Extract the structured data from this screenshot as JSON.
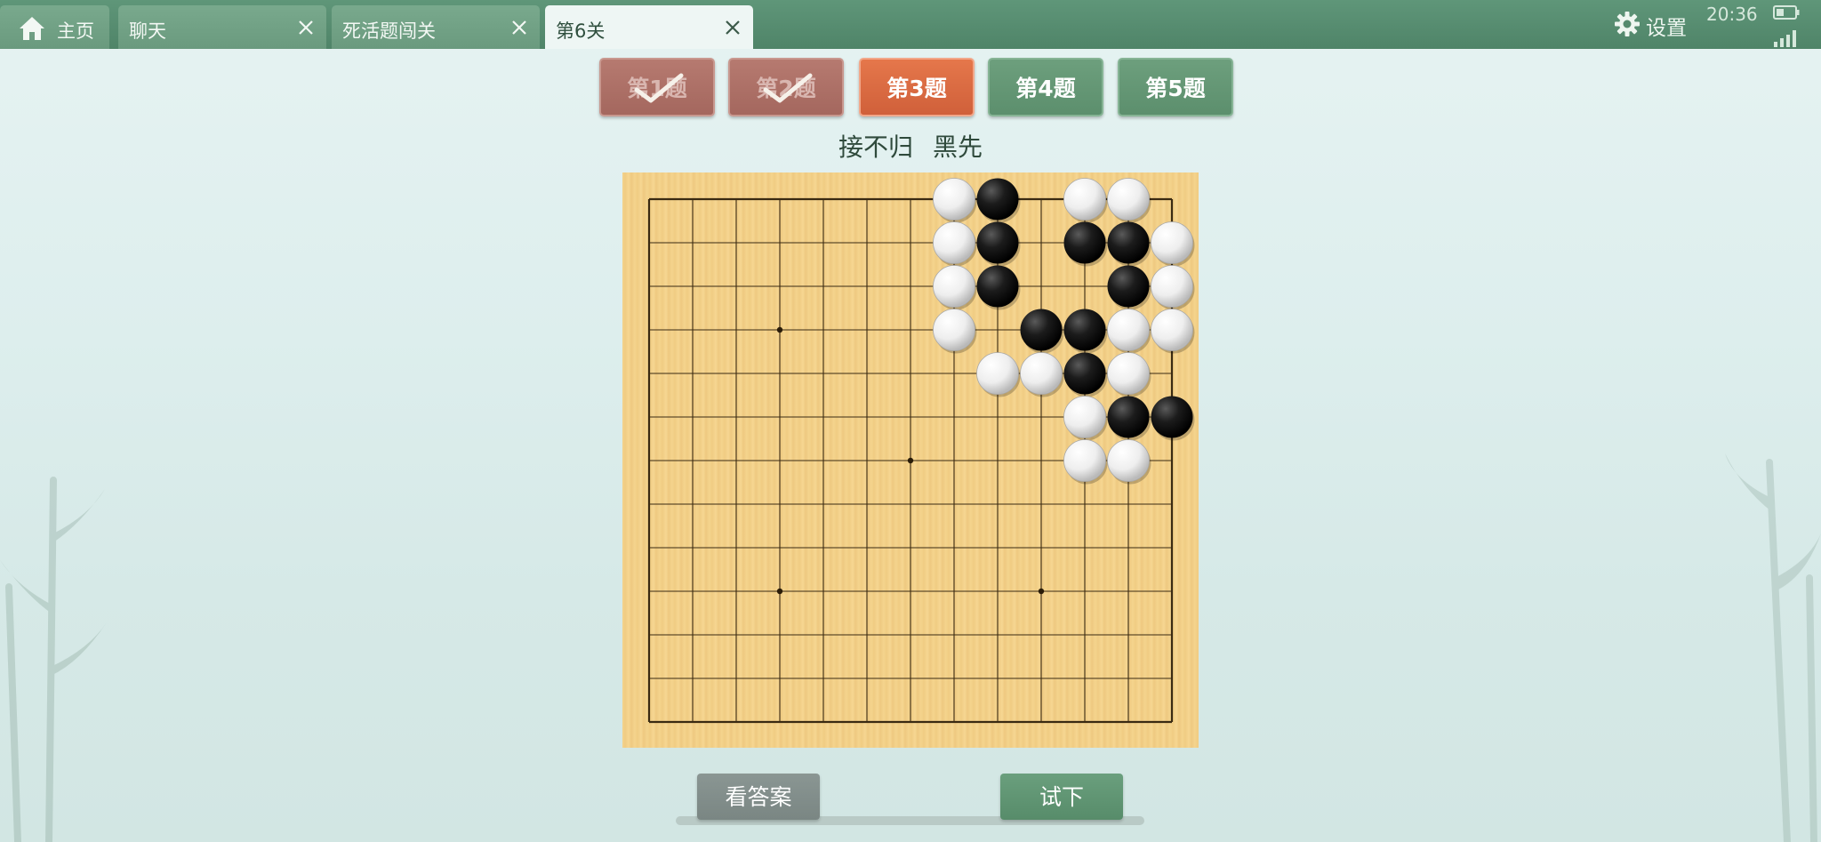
{
  "tabs": [
    {
      "label": "主页",
      "icon": "home-icon",
      "closable": false,
      "active": false
    },
    {
      "label": "聊天",
      "closable": true,
      "active": false
    },
    {
      "label": "死活题闯关",
      "closable": true,
      "active": false
    },
    {
      "label": "第6关",
      "closable": true,
      "active": true
    }
  ],
  "status": {
    "settings_label": "设置",
    "settings_icon": "gear-icon",
    "time": "20:36",
    "battery_icon": "battery-icon",
    "signal_icon": "signal-icon"
  },
  "problems": [
    {
      "label": "第1题",
      "state": "done"
    },
    {
      "label": "第2题",
      "state": "done"
    },
    {
      "label": "第3题",
      "state": "current"
    },
    {
      "label": "第4题",
      "state": "todo"
    },
    {
      "label": "第5题",
      "state": "todo"
    }
  ],
  "problem": {
    "theme": "接不归",
    "to_play": "黑先"
  },
  "board": {
    "size": 13,
    "star_points": [
      [
        3,
        3
      ],
      [
        6,
        6
      ],
      [
        3,
        9
      ],
      [
        9,
        9
      ]
    ],
    "stones": [
      {
        "color": "white",
        "col": 7,
        "row": 0
      },
      {
        "color": "black",
        "col": 8,
        "row": 0
      },
      {
        "color": "white",
        "col": 10,
        "row": 0
      },
      {
        "color": "white",
        "col": 11,
        "row": 0
      },
      {
        "color": "white",
        "col": 7,
        "row": 1
      },
      {
        "color": "black",
        "col": 8,
        "row": 1
      },
      {
        "color": "black",
        "col": 10,
        "row": 1
      },
      {
        "color": "black",
        "col": 11,
        "row": 1
      },
      {
        "color": "white",
        "col": 12,
        "row": 1
      },
      {
        "color": "white",
        "col": 7,
        "row": 2
      },
      {
        "color": "black",
        "col": 8,
        "row": 2
      },
      {
        "color": "black",
        "col": 11,
        "row": 2
      },
      {
        "color": "white",
        "col": 12,
        "row": 2
      },
      {
        "color": "white",
        "col": 7,
        "row": 3
      },
      {
        "color": "black",
        "col": 9,
        "row": 3
      },
      {
        "color": "black",
        "col": 10,
        "row": 3
      },
      {
        "color": "white",
        "col": 11,
        "row": 3
      },
      {
        "color": "white",
        "col": 12,
        "row": 3
      },
      {
        "color": "white",
        "col": 8,
        "row": 4
      },
      {
        "color": "white",
        "col": 9,
        "row": 4
      },
      {
        "color": "black",
        "col": 10,
        "row": 4
      },
      {
        "color": "white",
        "col": 11,
        "row": 4
      },
      {
        "color": "white",
        "col": 10,
        "row": 5
      },
      {
        "color": "black",
        "col": 11,
        "row": 5
      },
      {
        "color": "black",
        "col": 12,
        "row": 5
      },
      {
        "color": "white",
        "col": 10,
        "row": 6
      },
      {
        "color": "white",
        "col": 11,
        "row": 6
      }
    ]
  },
  "actions": {
    "answer_label": "看答案",
    "try_label": "试下"
  },
  "colors": {
    "topbar": "#558a6d",
    "done": "#a86b62",
    "current": "#d8663f",
    "todo": "#61946f",
    "board": "#f3d28c"
  }
}
